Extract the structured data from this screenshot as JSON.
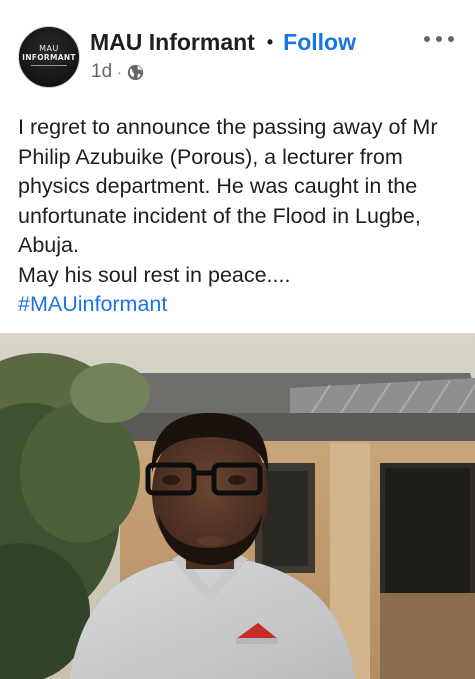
{
  "post": {
    "author": {
      "name": "MAU Informant",
      "avatar_logo_line1": "MAU",
      "avatar_logo_line2": "INFORMANT"
    },
    "follow_label": "Follow",
    "separator": "•",
    "timestamp": "1d",
    "meta_separator": "·",
    "privacy_icon": "globe-icon",
    "more_icon": "more-options-icon",
    "body_paragraphs": [
      "I regret to announce the passing away of Mr Philip Azubuike (Porous), a lecturer from physics department. He was caught in the unfortunate incident of the Flood in Lugbe, Abuja.",
      "May his soul rest in peace...."
    ],
    "hashtag": "#MAUinformant",
    "photo": {
      "description_visible": false
    }
  },
  "colors": {
    "link_blue": "#1b74e4",
    "text_primary": "#1c1e21",
    "text_secondary": "#65676b",
    "background": "#ffffff"
  }
}
